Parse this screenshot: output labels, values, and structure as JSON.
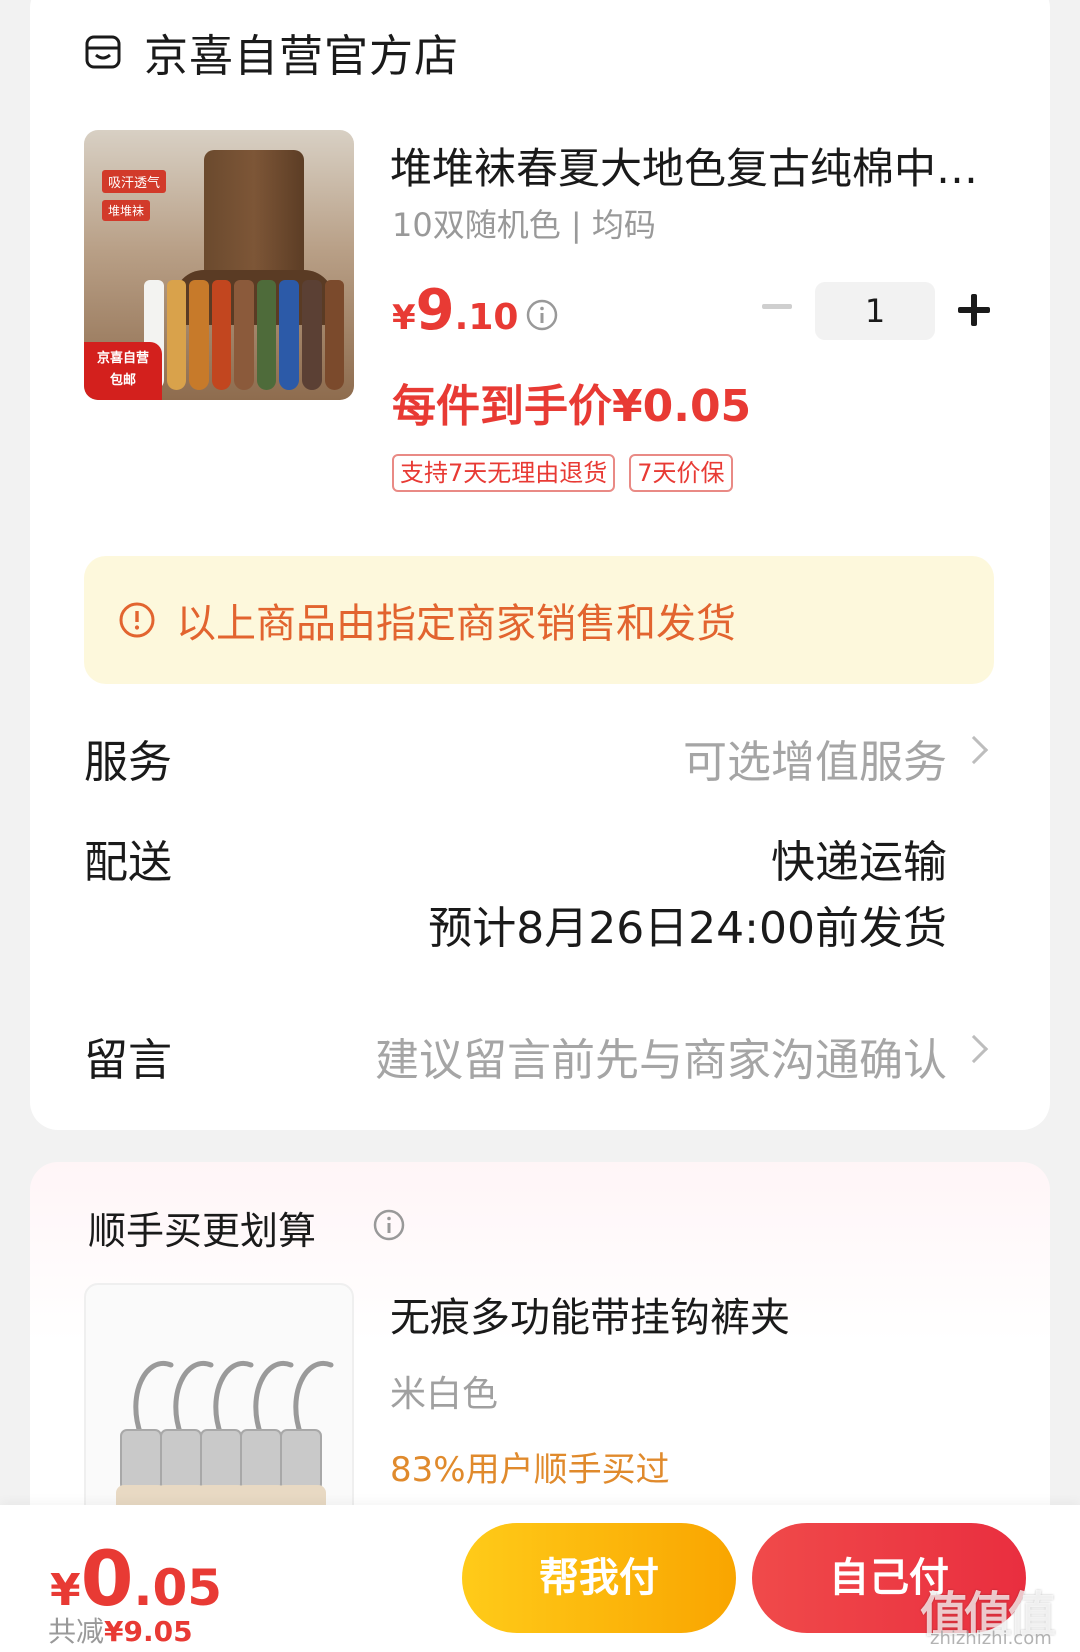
{
  "shop": {
    "name": "京喜自营官方店",
    "icon": "shop-icon"
  },
  "product": {
    "title": "堆堆袜春夏大地色复古纯棉中筒袜",
    "spec": "10双随机色 | 均码",
    "price_currency": "¥",
    "price_int": "9",
    "price_dec": ".10",
    "quantity": "1",
    "final_price": "每件到手价¥0.05",
    "tags": [
      "支持7天无理由退货",
      "7天价保"
    ],
    "image_tag1": "吸汗透气",
    "image_tag2": "堆堆袜",
    "image_badge_line1": "京喜自营",
    "image_badge_line2": "包邮"
  },
  "notice": {
    "text": "以上商品由指定商家销售和发货",
    "icon": "info-circle-icon"
  },
  "service": {
    "label": "服务",
    "value": "可选增值服务"
  },
  "delivery": {
    "label": "配送",
    "method": "快递运输",
    "eta": "预计8月26日24:00前发货"
  },
  "message": {
    "label": "留言",
    "placeholder": "建议留言前先与商家沟通确认"
  },
  "recommend": {
    "title": "顺手买更划算",
    "item": {
      "name": "无痕多功能带挂钩裤夹",
      "color": "米白色",
      "rate": "83%用户顺手买过"
    }
  },
  "footer": {
    "total_currency": "¥",
    "total_int": "0",
    "total_dec": ".05",
    "save_label": "共减",
    "save_value": "¥9.05",
    "help_pay": "帮我付",
    "self_pay": "自己付"
  },
  "watermark": {
    "text": "值值值",
    "sub": "zhizhizhi.com"
  },
  "colors": {
    "accent_red": "#e83a34",
    "notice_bg": "#fdf8dc",
    "notice_text": "#e2642f",
    "help_btn": "#f9a500",
    "self_btn": "#e92e3f"
  }
}
